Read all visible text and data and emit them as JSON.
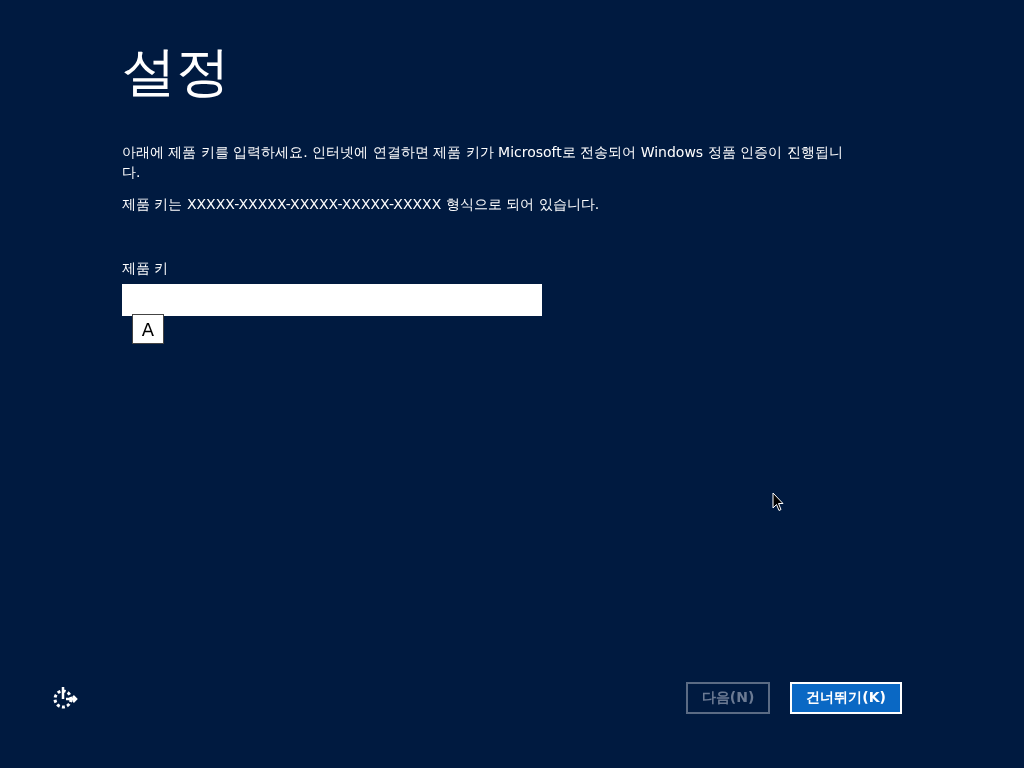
{
  "title": "설정",
  "instructions": [
    "아래에 제품 키를 입력하세요. 인터넷에 연결하면 제품 키가 Microsoft로 전송되어 Windows 정품 인증이 진행됩니다.",
    "제품 키는 XXXXX-XXXXX-XXXXX-XXXXX-XXXXX 형식으로 되어 있습니다."
  ],
  "product_key": {
    "label": "제품 키",
    "ime_mode": "A"
  },
  "buttons": [
    {
      "label": "다음(N)",
      "disabled": true,
      "primary": false
    },
    {
      "label": "건너뛰기(K)",
      "disabled": false,
      "primary": true
    }
  ]
}
